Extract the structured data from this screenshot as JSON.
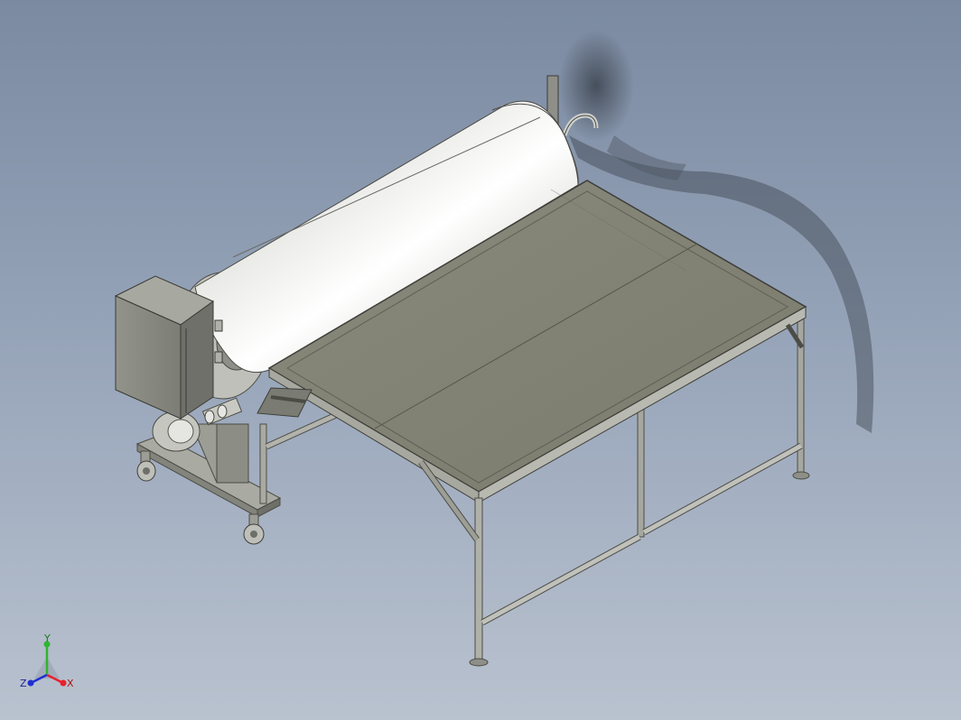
{
  "triad": {
    "x_label": "X",
    "y_label": "Y",
    "z_label": "Z",
    "x_color": "#e8202a",
    "y_color": "#2fb52f",
    "z_color": "#2030d0"
  }
}
